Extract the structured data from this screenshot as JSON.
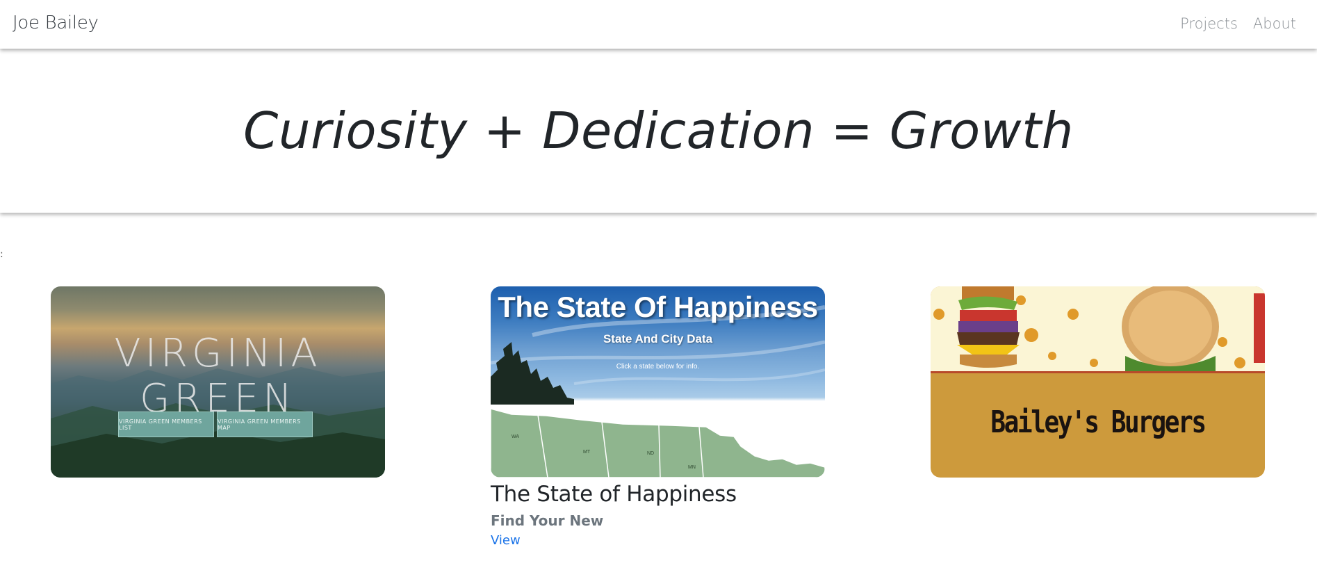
{
  "navbar": {
    "brand": "Joe Bailey",
    "links": [
      {
        "label": "Projects"
      },
      {
        "label": "About"
      }
    ]
  },
  "hero": {
    "title": "Curiosity + Dedication = Growth"
  },
  "projects": [
    {
      "thumb_title": "VIRGINIA GREEN",
      "thumb_buttons": [
        "VIRGINIA GREEN MEMBERS LIST",
        "VIRGINIA GREEN MEMBERS MAP"
      ]
    },
    {
      "thumb_title": "The State Of Happiness",
      "thumb_subtitle": "State And City Data",
      "thumb_hint": "Click a state below for info.",
      "map_labels": [
        "WA",
        "MT",
        "ND",
        "MN"
      ],
      "title": "The State of Happiness",
      "subtitle": "Find Your New",
      "link": "View"
    },
    {
      "thumb_title": "Bailey's Burgers"
    }
  ],
  "colors": {
    "link": "#1a73e8",
    "subtitle": "#6c757d",
    "map_land": "#8fb58e",
    "burger_background": "#cd9a3c"
  }
}
